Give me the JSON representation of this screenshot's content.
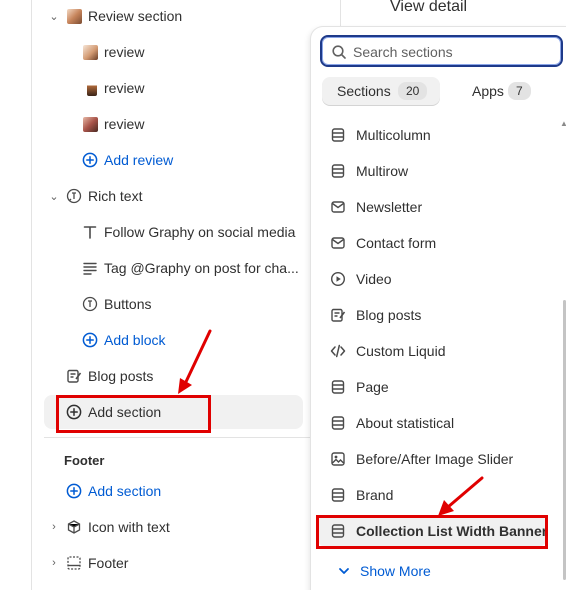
{
  "left": {
    "items": [
      {
        "label": "Review section"
      },
      {
        "label": "review"
      },
      {
        "label": "review"
      },
      {
        "label": "review"
      },
      {
        "label": "Add review"
      },
      {
        "label": "Rich text"
      },
      {
        "label": "Follow Graphy on social media"
      },
      {
        "label": "Tag @Graphy on post for cha..."
      },
      {
        "label": "Buttons"
      },
      {
        "label": "Add block"
      },
      {
        "label": "Blog posts"
      },
      {
        "label": "Add section"
      }
    ],
    "footer_group": {
      "heading": "Footer",
      "add_section": "Add section",
      "items": [
        {
          "label": "Icon with text"
        },
        {
          "label": "Footer"
        }
      ]
    }
  },
  "picker": {
    "header_text": "View detail",
    "search_placeholder": "Search sections",
    "tabs": [
      {
        "label": "Sections",
        "count": "20"
      },
      {
        "label": "Apps",
        "count": "7"
      }
    ],
    "sections": [
      {
        "label": "Multicolumn",
        "icon": "layout-rows-icon"
      },
      {
        "label": "Multirow",
        "icon": "layout-rows-icon"
      },
      {
        "label": "Newsletter",
        "icon": "email-icon"
      },
      {
        "label": "Contact form",
        "icon": "email-icon"
      },
      {
        "label": "Video",
        "icon": "play-icon"
      },
      {
        "label": "Blog posts",
        "icon": "blog-icon"
      },
      {
        "label": "Custom Liquid",
        "icon": "code-icon"
      },
      {
        "label": "Page",
        "icon": "layout-rows-icon"
      },
      {
        "label": "About statistical",
        "icon": "layout-rows-icon"
      },
      {
        "label": "Before/After Image Slider",
        "icon": "image-icon"
      },
      {
        "label": "Brand",
        "icon": "layout-rows-icon"
      },
      {
        "label": "Collection List Width Banner",
        "icon": "layout-rows-icon"
      }
    ],
    "show_more": "Show More"
  },
  "colors": {
    "accent": "#005bd3",
    "annotation_red": "#e00000",
    "highlight": "#f1f1f1"
  }
}
